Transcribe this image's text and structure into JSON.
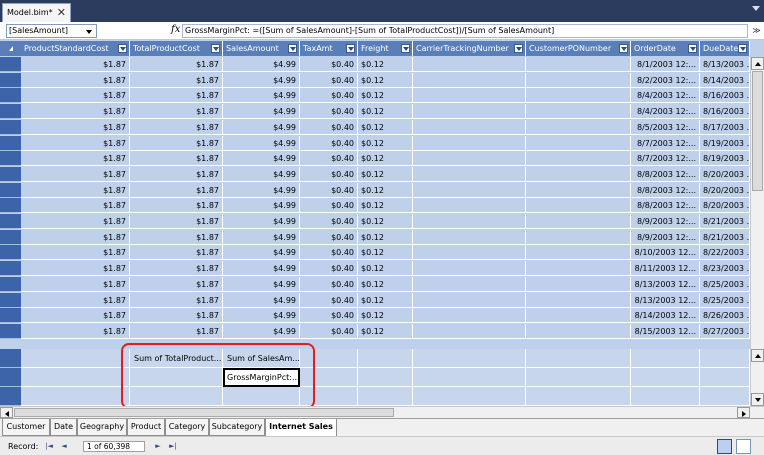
{
  "document": {
    "tab_label": "Model.bim*",
    "close_glyph": "✕"
  },
  "formula_bar": {
    "measure_selector": "[SalesAmount]",
    "fx_symbol": "fx",
    "formula": "GrossMarginPct: =([Sum of SalesAmount]-[Sum of TotalProductCost])/[Sum of SalesAmount]",
    "expand_glyph": "≫"
  },
  "columns": [
    "ProductStandardCost",
    "TotalProductCost",
    "SalesAmount",
    "TaxAmt",
    "Freight",
    "CarrierTrackingNumber",
    "CustomerPONumber",
    "OrderDate",
    "DueDate"
  ],
  "rows": [
    {
      "psc": "$1.87",
      "tpc": "$1.87",
      "sa": "$4.99",
      "tax": "$0.40",
      "fr": "$0.12",
      "od": "8/1/2003 12:...",
      "dd": "8/13/2003 ..."
    },
    {
      "psc": "$1.87",
      "tpc": "$1.87",
      "sa": "$4.99",
      "tax": "$0.40",
      "fr": "$0.12",
      "od": "8/2/2003 12:...",
      "dd": "8/14/2003 ..."
    },
    {
      "psc": "$1.87",
      "tpc": "$1.87",
      "sa": "$4.99",
      "tax": "$0.40",
      "fr": "$0.12",
      "od": "8/4/2003 12:...",
      "dd": "8/16/2003 ..."
    },
    {
      "psc": "$1.87",
      "tpc": "$1.87",
      "sa": "$4.99",
      "tax": "$0.40",
      "fr": "$0.12",
      "od": "8/4/2003 12:...",
      "dd": "8/16/2003 ..."
    },
    {
      "psc": "$1.87",
      "tpc": "$1.87",
      "sa": "$4.99",
      "tax": "$0.40",
      "fr": "$0.12",
      "od": "8/5/2003 12:...",
      "dd": "8/17/2003 ..."
    },
    {
      "psc": "$1.87",
      "tpc": "$1.87",
      "sa": "$4.99",
      "tax": "$0.40",
      "fr": "$0.12",
      "od": "8/7/2003 12:...",
      "dd": "8/19/2003 ..."
    },
    {
      "psc": "$1.87",
      "tpc": "$1.87",
      "sa": "$4.99",
      "tax": "$0.40",
      "fr": "$0.12",
      "od": "8/7/2003 12:...",
      "dd": "8/19/2003 ..."
    },
    {
      "psc": "$1.87",
      "tpc": "$1.87",
      "sa": "$4.99",
      "tax": "$0.40",
      "fr": "$0.12",
      "od": "8/8/2003 12:...",
      "dd": "8/20/2003 ..."
    },
    {
      "psc": "$1.87",
      "tpc": "$1.87",
      "sa": "$4.99",
      "tax": "$0.40",
      "fr": "$0.12",
      "od": "8/8/2003 12:...",
      "dd": "8/20/2003 ..."
    },
    {
      "psc": "$1.87",
      "tpc": "$1.87",
      "sa": "$4.99",
      "tax": "$0.40",
      "fr": "$0.12",
      "od": "8/8/2003 12:...",
      "dd": "8/20/2003 ..."
    },
    {
      "psc": "$1.87",
      "tpc": "$1.87",
      "sa": "$4.99",
      "tax": "$0.40",
      "fr": "$0.12",
      "od": "8/9/2003 12:...",
      "dd": "8/21/2003 ..."
    },
    {
      "psc": "$1.87",
      "tpc": "$1.87",
      "sa": "$4.99",
      "tax": "$0.40",
      "fr": "$0.12",
      "od": "8/9/2003 12:...",
      "dd": "8/21/2003 ..."
    },
    {
      "psc": "$1.87",
      "tpc": "$1.87",
      "sa": "$4.99",
      "tax": "$0.40",
      "fr": "$0.12",
      "od": "8/10/2003 12...",
      "dd": "8/22/2003 ..."
    },
    {
      "psc": "$1.87",
      "tpc": "$1.87",
      "sa": "$4.99",
      "tax": "$0.40",
      "fr": "$0.12",
      "od": "8/11/2003 12...",
      "dd": "8/23/2003 ..."
    },
    {
      "psc": "$1.87",
      "tpc": "$1.87",
      "sa": "$4.99",
      "tax": "$0.40",
      "fr": "$0.12",
      "od": "8/13/2003 12...",
      "dd": "8/25/2003 ..."
    },
    {
      "psc": "$1.87",
      "tpc": "$1.87",
      "sa": "$4.99",
      "tax": "$0.40",
      "fr": "$0.12",
      "od": "8/13/2003 12...",
      "dd": "8/25/2003 ..."
    },
    {
      "psc": "$1.87",
      "tpc": "$1.87",
      "sa": "$4.99",
      "tax": "$0.40",
      "fr": "$0.12",
      "od": "8/14/2003 12...",
      "dd": "8/26/2003 ..."
    },
    {
      "psc": "$1.87",
      "tpc": "$1.87",
      "sa": "$4.99",
      "tax": "$0.40",
      "fr": "$0.12",
      "od": "8/15/2003 12...",
      "dd": "8/27/2003 ..."
    }
  ],
  "measures": {
    "sum_total_product_cost": "Sum of TotalProduct...",
    "sum_sales_amount": "Sum of SalesAm...",
    "gross_margin_pct": "GrossMarginPct:..."
  },
  "sheet_tabs": [
    "Customer",
    "Date",
    "Geography",
    "Product",
    "Category",
    "Subcategory",
    "Internet Sales"
  ],
  "active_sheet": "Internet Sales",
  "status": {
    "record_label": "Record:",
    "nav_first": "|◄",
    "nav_prev": "◄",
    "record_value": "1 of 60,398",
    "nav_next": "►",
    "nav_last": "►|"
  },
  "colors": {
    "header_bg": "#5a7fb8",
    "row_header_bg": "#3d64a8",
    "cell_bg": "#bed0ea",
    "highlight": "#e02020",
    "tabbar_bg": "#2b3c5f"
  }
}
